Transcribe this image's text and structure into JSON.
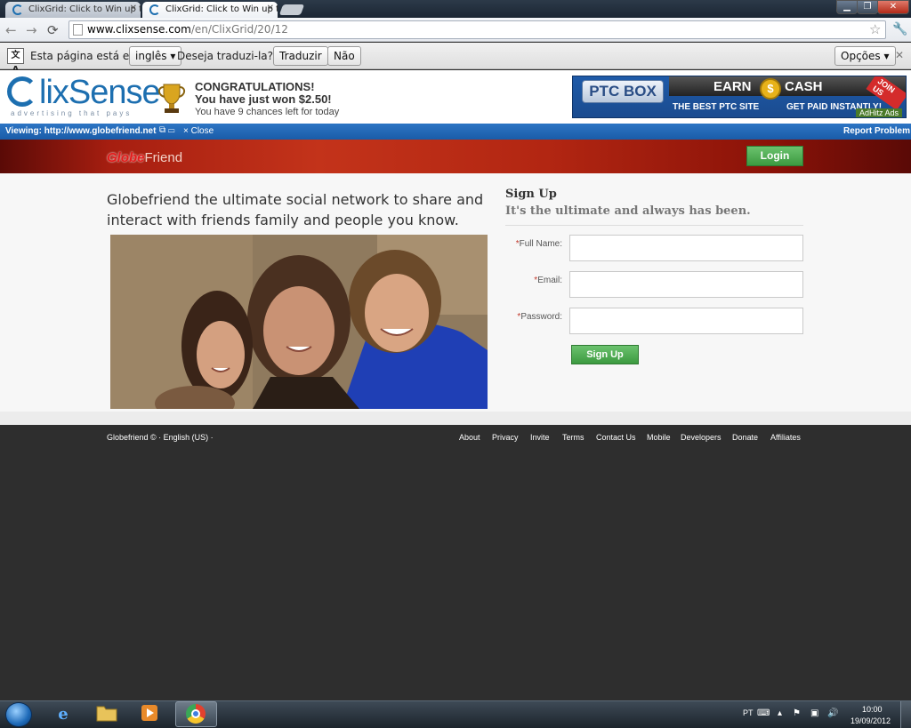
{
  "browser": {
    "tabs": [
      {
        "title": "ClixGrid: Click to Win up to",
        "active": false
      },
      {
        "title": "ClixGrid: Click to Win up to",
        "active": true
      }
    ],
    "url_host": "www.clixsense.com",
    "url_path": "/en/ClixGrid/20/12"
  },
  "translate_bar": {
    "text_before": "Esta página está em",
    "language": "inglês",
    "question": "Deseja traduzi-la?",
    "translate_label": "Traduzir",
    "no_label": "Não",
    "options_label": "Opções"
  },
  "clixsense": {
    "logo_text": "lixSense",
    "logo_tagline": "advertising that pays",
    "congrats_line1": "CONGRATULATIONS!",
    "congrats_line2": "You have just won $2.50!",
    "congrats_line3": "You have 9 chances left for today",
    "ad": {
      "ptc_box": "PTC BOX",
      "earn": "EARN",
      "cash": "CASH",
      "best": "THE BEST PTC SITE",
      "paid": "GET PAID INSTANTLY!",
      "join": "JOIN US",
      "adhitz": "AdHitz Ads"
    }
  },
  "viewing_bar": {
    "viewing": "Viewing: http://www.globefriend.net",
    "close": "× Close",
    "report": "Report Problem"
  },
  "globefriend": {
    "logo_globe": "Globe",
    "logo_friend": "Friend",
    "login_label": "Login",
    "tagline": "Globefriend the ultimate social network to share and interact with friends family and people you know.",
    "signup_title": "Sign Up",
    "signup_subtitle": "It's the ultimate and always has been.",
    "fields": [
      {
        "label": "Full Name:"
      },
      {
        "label": "Email:"
      },
      {
        "label": "Password:"
      }
    ],
    "signup_button": "Sign Up",
    "footer_left": "Globefriend © · English (US) ·",
    "footer_links": [
      "About",
      "Privacy",
      "Invite",
      "Terms",
      "Contact Us",
      "Mobile",
      "Developers",
      "Donate",
      "Affiliates"
    ]
  },
  "taskbar": {
    "language": "PT",
    "time": "10:00",
    "date": "19/09/2012"
  },
  "colors": {
    "clixsense_blue": "#1d6fb0",
    "viewbar_blue": "#1a5ca8",
    "globefriend_red": "#b22612",
    "button_green": "#3c9a40",
    "footer_dark": "#2e2e2e"
  },
  "icons": [
    "back-arrow-icon",
    "forward-arrow-icon",
    "reload-icon",
    "page-icon",
    "star-icon",
    "wrench-icon",
    "translate-icon",
    "trophy-icon",
    "coin-icon",
    "windows-start-icon",
    "ie-icon",
    "folder-icon",
    "media-player-icon",
    "chrome-icon",
    "flag-icon",
    "network-icon",
    "volume-icon"
  ]
}
